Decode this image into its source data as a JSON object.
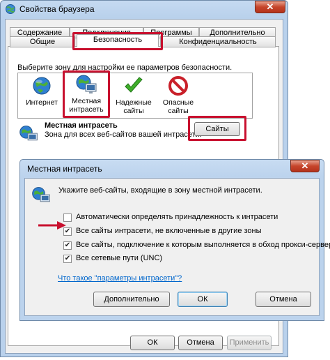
{
  "outer_window": {
    "title": "Свойства браузера",
    "close_glyph": "✕"
  },
  "tabs": {
    "row_back": [
      "Содержание",
      "Подключения",
      "Программы",
      "Дополнительно"
    ],
    "row_front": [
      "Общие",
      "Безопасность",
      "Конфиденциальность"
    ],
    "active": "Безопасность"
  },
  "security": {
    "zone_prompt": "Выберите зону для настройки ее параметров безопасности.",
    "zones": [
      {
        "label_lines": [
          "Интернет"
        ],
        "icon": "globe-icon"
      },
      {
        "label_lines": [
          "Местная",
          "интрасеть"
        ],
        "icon": "local-intranet-icon"
      },
      {
        "label_lines": [
          "Надежные",
          "сайты"
        ],
        "icon": "checkmark-icon"
      },
      {
        "label_lines": [
          "Опасные",
          "сайты"
        ],
        "icon": "no-entry-icon"
      }
    ],
    "selected_zone_title": "Местная интрасеть",
    "selected_zone_desc": "Зона для всех веб-сайтов вашей интрасети.",
    "sites_button": "Сайты"
  },
  "footer": {
    "ok": "ОК",
    "cancel": "Отмена",
    "apply": "Применить"
  },
  "intranet_dialog": {
    "title": "Местная интрасеть",
    "close_glyph": "✕",
    "instruction": "Укажите веб-сайты, входящие в зону местной интрасети.",
    "options": [
      {
        "label": "Автоматически определять принадлежность к интрасети",
        "checked": false
      },
      {
        "label": "Все сайты интрасети, не включенные в другие зоны",
        "checked": true
      },
      {
        "label": "Все сайты, подключение к которым выполняется в обход прокси-сервера",
        "checked": true
      },
      {
        "label": "Все сетевые пути (UNC)",
        "checked": true
      }
    ],
    "help_link": "Что такое \"параметры интрасети\"?",
    "advanced_button": "Дополнительно",
    "ok_button": "ОК",
    "cancel_button": "Отмена",
    "check_glyph": "✔"
  },
  "colors": {
    "highlight_red": "#c8102e",
    "link_blue": "#0066cc",
    "window_frame": "#b9d1ec"
  }
}
